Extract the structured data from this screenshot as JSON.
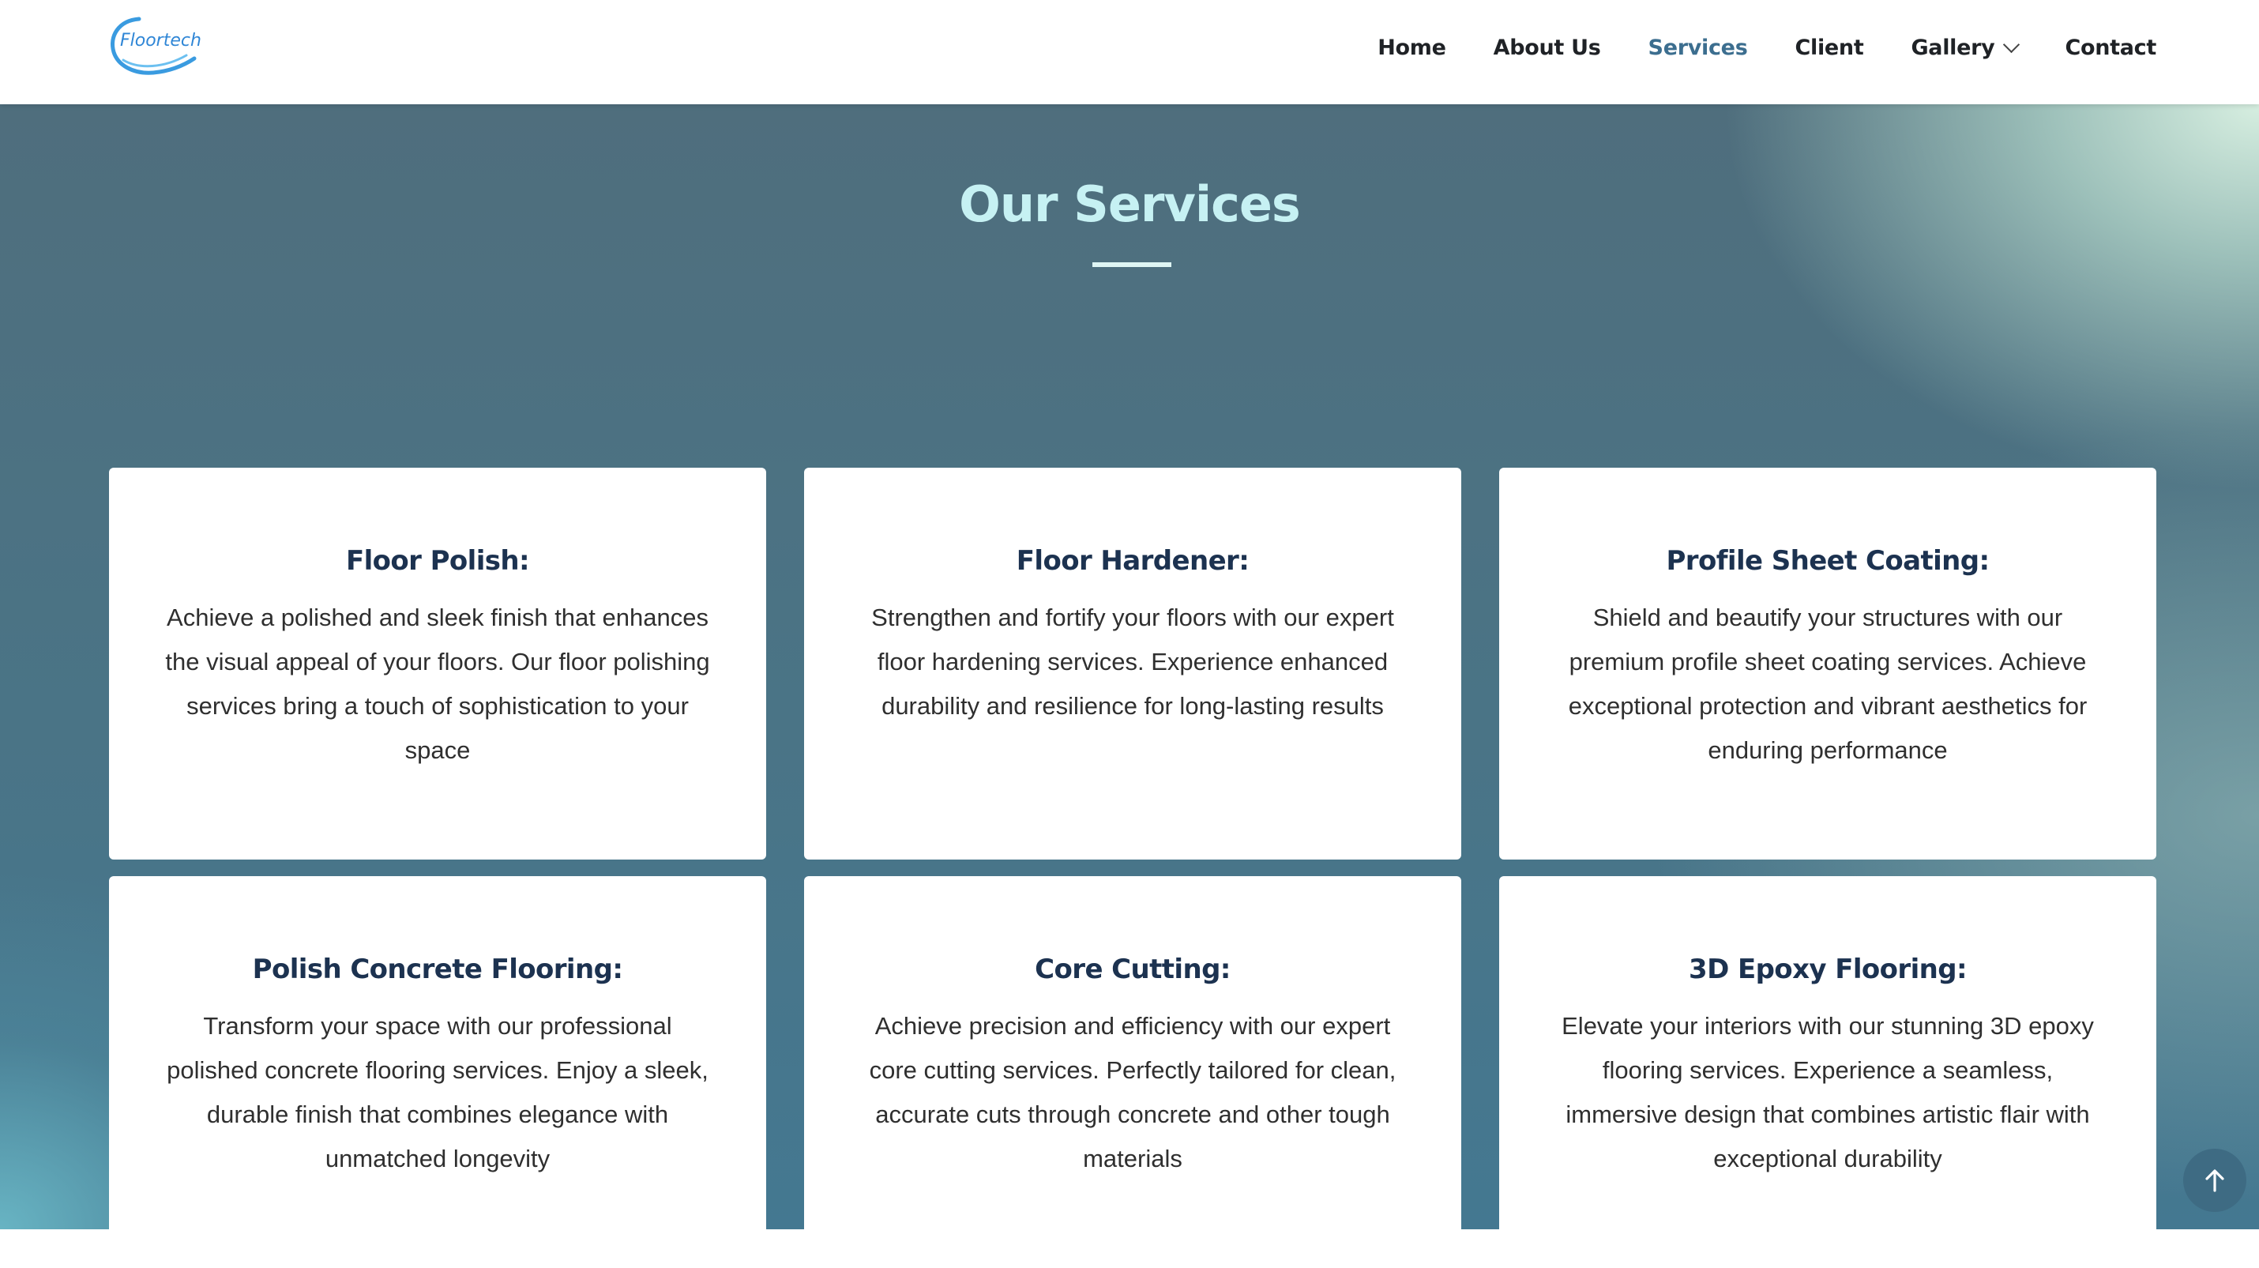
{
  "header": {
    "logo_text": "Floortech",
    "nav": [
      {
        "label": "Home",
        "active": false
      },
      {
        "label": "About Us",
        "active": false
      },
      {
        "label": "Services",
        "active": true
      },
      {
        "label": "Client",
        "active": false
      },
      {
        "label": "Gallery",
        "active": false,
        "has_dropdown": true
      },
      {
        "label": "Contact",
        "active": false
      }
    ]
  },
  "section": {
    "title": "Our Services"
  },
  "services": [
    {
      "title": "Floor Polish:",
      "description": "Achieve a polished and sleek finish that enhances the visual appeal of your floors. Our floor polishing services bring a touch of sophistication to your space"
    },
    {
      "title": "Floor Hardener:",
      "description": "Strengthen and fortify your floors with our expert floor hardening services. Experience enhanced durability and resilience for long-lasting results"
    },
    {
      "title": "Profile Sheet Coating:",
      "description": "Shield and beautify your structures with our premium profile sheet coating services. Achieve exceptional protection and vibrant aesthetics for enduring performance"
    },
    {
      "title": "Polish Concrete Flooring:",
      "description": "Transform your space with our professional polished concrete flooring services. Enjoy a sleek, durable finish that combines elegance with unmatched longevity"
    },
    {
      "title": "Core Cutting:",
      "description": "Achieve precision and efficiency with our expert core cutting services. Perfectly tailored for clean, accurate cuts through concrete and other tough materials"
    },
    {
      "title": "3D Epoxy Flooring:",
      "description": "Elevate your interiors with our stunning 3D epoxy flooring services. Experience a seamless, immersive design that combines artistic flair with exceptional durability"
    }
  ],
  "icons": {
    "back_to_top": "arrow-up-icon",
    "gallery_dropdown": "chevron-down-icon"
  },
  "colors": {
    "accent": "#3c6e8f",
    "title": "#c6f1f3",
    "card_heading": "#1c3250"
  }
}
